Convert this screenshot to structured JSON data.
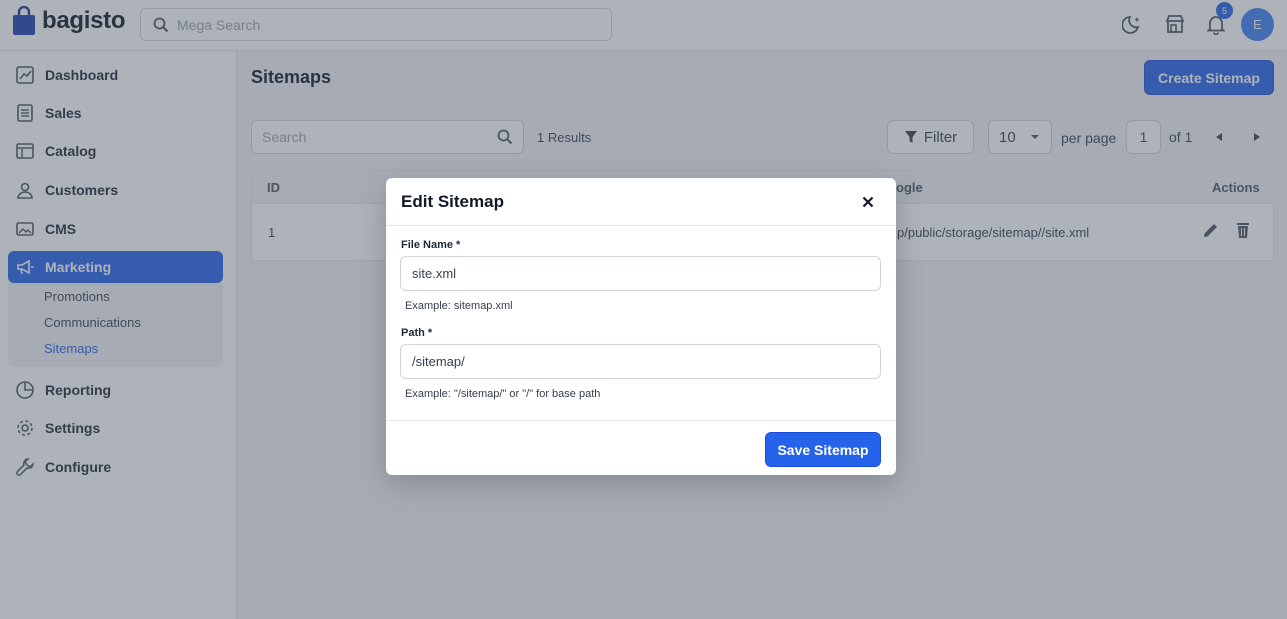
{
  "header": {
    "brand": "bagisto",
    "search_placeholder": "Mega Search",
    "notification_count": "5",
    "avatar_initial": "E"
  },
  "sidebar": {
    "items": [
      {
        "label": "Dashboard",
        "icon": "dashboard-icon"
      },
      {
        "label": "Sales",
        "icon": "sales-icon"
      },
      {
        "label": "Catalog",
        "icon": "catalog-icon"
      },
      {
        "label": "Customers",
        "icon": "customers-icon"
      },
      {
        "label": "CMS",
        "icon": "cms-icon"
      },
      {
        "label": "Marketing",
        "icon": "megaphone-icon",
        "active": true
      },
      {
        "label": "Reporting",
        "icon": "reporting-icon"
      },
      {
        "label": "Settings",
        "icon": "gear-icon"
      },
      {
        "label": "Configure",
        "icon": "wrench-icon"
      }
    ],
    "marketing_sub": [
      "Promotions",
      "Communications",
      "Sitemaps"
    ]
  },
  "main": {
    "title": "Sitemaps",
    "create_label": "Create Sitemap",
    "search_placeholder": "Search",
    "results": "1 Results",
    "filter_label": "Filter",
    "per_page_value": "10",
    "per_page_label": "per page",
    "page_value": "1",
    "of_label": "of 1",
    "table": {
      "columns": [
        "ID",
        "ogle",
        "Actions"
      ],
      "rows": [
        {
          "id": "1",
          "path_fragment": "p/public/storage/sitemap//site.xml"
        }
      ]
    }
  },
  "modal": {
    "title": "Edit Sitemap",
    "file_name_label": "File Name *",
    "file_name_value": "site.xml",
    "file_name_help": "Example: sitemap.xml",
    "path_label": "Path *",
    "path_value": "/sitemap/",
    "path_help": "Example: \"/sitemap/\" or \"/\" for base path",
    "save_label": "Save Sitemap"
  },
  "colors": {
    "accent": "#2563eb",
    "overlay": "rgba(75,85,99,0.45)"
  }
}
